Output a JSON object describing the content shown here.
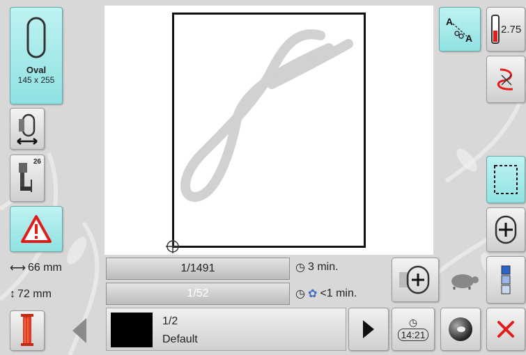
{
  "hoop": {
    "name": "Oval",
    "size": "145 x 255"
  },
  "stitch_count": "1/1491",
  "color_progress": "1/52",
  "total_time": "3 min.",
  "color_time": "<1 min.",
  "width": "66 mm",
  "height": "72 mm",
  "temperature_value": "2.75",
  "feed_badge": "26",
  "clock_time": "14:21",
  "color_step": {
    "index": "1/2",
    "name": "Default"
  },
  "colors": {
    "accent_active": "#8fe2e2",
    "warning": "#e21b1b",
    "thread": "#e03c20",
    "cancel": "#e21b1b"
  },
  "icons": [
    "hoop-oval-icon",
    "move-hoop-icon",
    "presser-foot-icon",
    "warning-icon",
    "thread-spool-icon",
    "left-arrow-icon",
    "play-icon",
    "clock-icon",
    "ball-icon",
    "cancel-icon",
    "rotate-slow-icon",
    "color-list-icon",
    "frame-select-icon",
    "center-icon",
    "stitch-edit-icon",
    "cut-jump-icon",
    "tension-icon"
  ]
}
